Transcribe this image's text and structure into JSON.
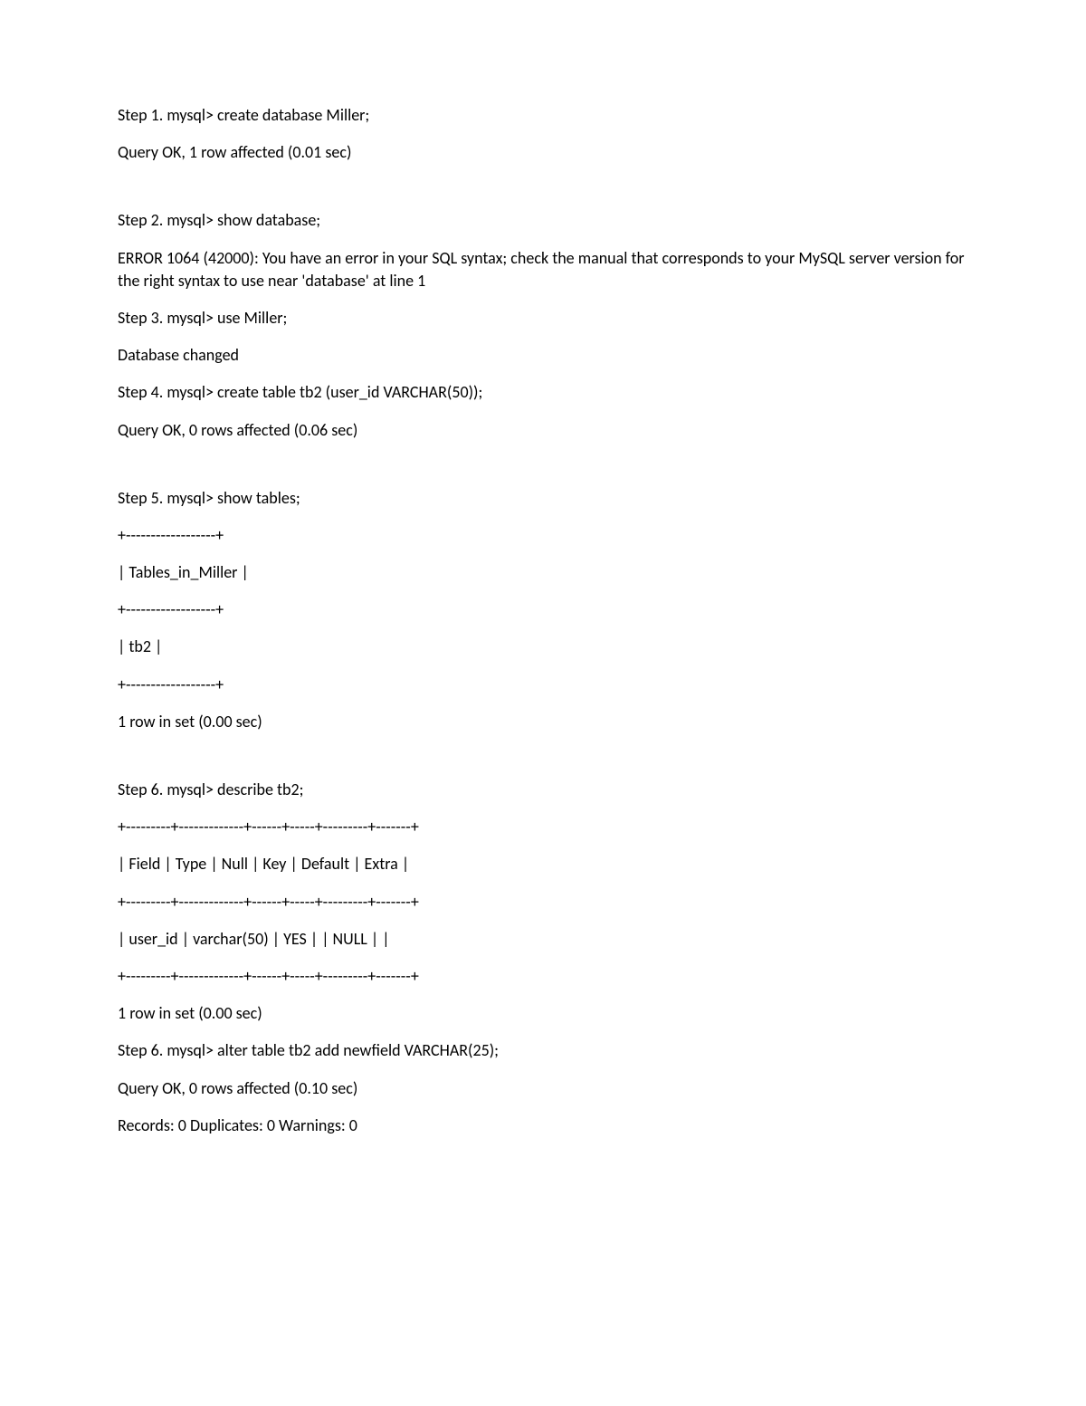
{
  "lines": [
    "Step 1. mysql> create database Miller;",
    "Query OK, 1 row affected (0.01 sec)",
    "",
    "Step 2. mysql> show database;",
    "ERROR 1064 (42000): You have an error in your SQL syntax; check the manual that corresponds to your MySQL server version for the right syntax to use near 'database' at line 1",
    "Step 3. mysql> use Miller;",
    "Database changed",
    "Step 4. mysql> create table tb2 (user_id VARCHAR(50));",
    "Query OK, 0 rows affected (0.06 sec)",
    "",
    "Step 5. mysql> show tables;",
    "+------------------+",
    "| Tables_in_Miller |",
    "+------------------+",
    "| tb2              |",
    "+------------------+",
    "1 row in set (0.00 sec)",
    "",
    "Step 6. mysql> describe tb2;",
    "+---------+-------------+------+-----+---------+-------+",
    "| Field   | Type        | Null | Key | Default | Extra |",
    "+---------+-------------+------+-----+---------+-------+",
    "| user_id | varchar(50) | YES  |     | NULL    |       |",
    "+---------+-------------+------+-----+---------+-------+",
    "1 row in set (0.00 sec)",
    "Step 6. mysql> alter table tb2 add newfield VARCHAR(25);",
    "Query OK, 0 rows affected (0.10 sec)",
    "Records: 0  Duplicates: 0  Warnings: 0"
  ]
}
